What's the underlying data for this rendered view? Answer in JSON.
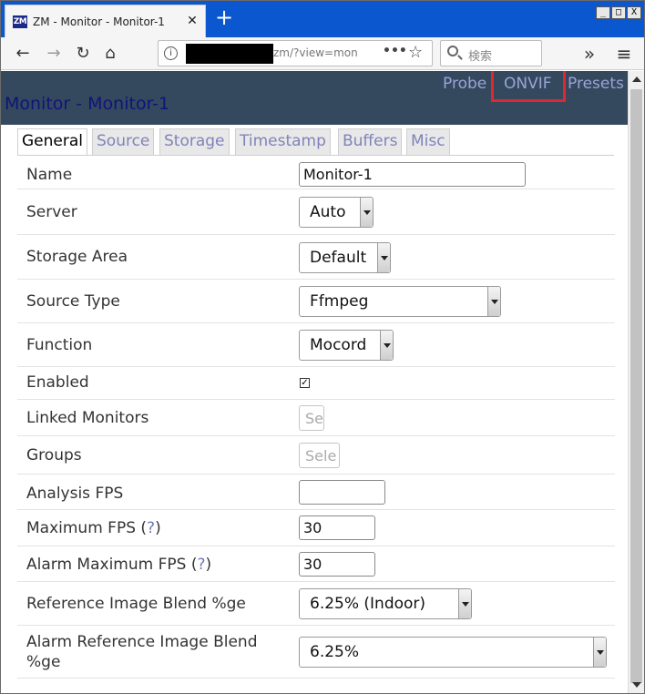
{
  "browser": {
    "tab_title": "ZM - Monitor - Monitor-1",
    "favicon_text": "ZM",
    "new_tab": "+",
    "url_visible": "zm/?view=mon",
    "search_placeholder": "検索",
    "window_controls": [
      "_",
      "□",
      "X"
    ],
    "overflow": "»",
    "menu": "≡"
  },
  "header": {
    "links": [
      "Probe",
      "ONVIF",
      "Presets"
    ],
    "title": "Monitor - Monitor-1"
  },
  "tabs": [
    "General",
    "Source",
    "Storage",
    "Timestamp",
    "Buffers",
    "Misc"
  ],
  "active_tab": "General",
  "form": {
    "name": {
      "label": "Name",
      "value": "Monitor-1"
    },
    "server": {
      "label": "Server",
      "value": "Auto"
    },
    "storage_area": {
      "label": "Storage Area",
      "value": "Default"
    },
    "source_type": {
      "label": "Source Type",
      "value": "Ffmpeg"
    },
    "function": {
      "label": "Function",
      "value": "Mocord"
    },
    "enabled": {
      "label": "Enabled",
      "checked": true,
      "mark": "✓"
    },
    "linked_monitors": {
      "label": "Linked Monitors",
      "value": "Se"
    },
    "groups": {
      "label": "Groups",
      "value": "Sele"
    },
    "analysis_fps": {
      "label": "Analysis FPS",
      "value": ""
    },
    "maximum_fps": {
      "label": "Maximum FPS",
      "help": "?",
      "value": "30"
    },
    "alarm_maximum_fps": {
      "label": "Alarm Maximum FPS",
      "help": "?",
      "value": "30"
    },
    "ref_blend": {
      "label": "Reference Image Blend %ge",
      "value": "6.25% (Indoor)"
    },
    "alarm_ref_blend": {
      "label_line1": "Alarm Reference Image Blend",
      "label_line2": "%ge",
      "value": "6.25%"
    }
  },
  "colors": {
    "header_bg": "#34495e",
    "header_link": "#9aa3d6",
    "title": "#10147a",
    "highlight": "#e0262e",
    "browser_chrome": "#0a57cf"
  }
}
